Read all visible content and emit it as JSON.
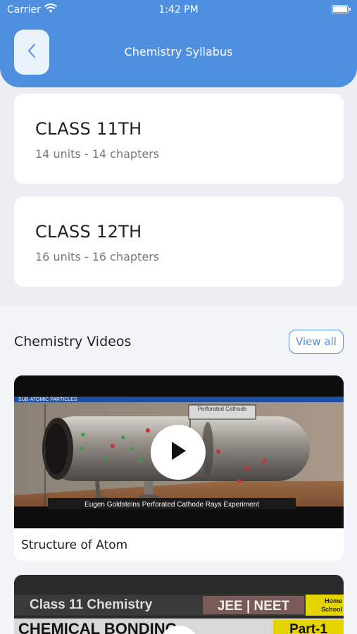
{
  "status_bar": {
    "carrier": "Carrier",
    "time": "1:42 PM",
    "battery_level": 1.0
  },
  "header": {
    "title": "Chemistry Syllabus",
    "back_icon": "chevron-left-icon"
  },
  "classes": [
    {
      "title": "CLASS 11TH",
      "subtitle": "14 units - 14 chapters"
    },
    {
      "title": "CLASS 12TH",
      "subtitle": "16 units - 16 chapters"
    }
  ],
  "videos_section": {
    "title": "Chemistry Videos",
    "view_all_label": "View all",
    "videos": [
      {
        "title": "Structure of Atom",
        "thumb_banner": "SUB-ATOMIC PARTICLES",
        "thumb_label": "Perforated Cathode",
        "thumb_caption": "Eugen Goldsteins Perforated Cathode Rays Experiment"
      },
      {
        "thumb_line1": "Class 11 Chemistry",
        "thumb_badge": "JEE | NEET",
        "thumb_brand": "Home School",
        "thumb_line2": "CHEMICAL BONDING",
        "thumb_part": "Part-1"
      }
    ]
  },
  "colors": {
    "accent": "#4f8fe0",
    "card": "#ffffff",
    "background": "#eceef1"
  }
}
